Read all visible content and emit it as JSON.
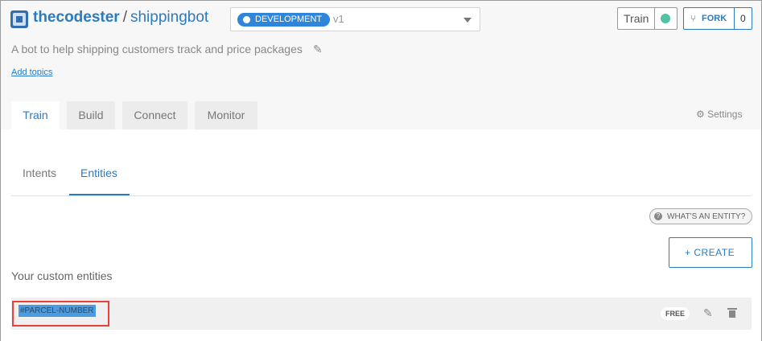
{
  "header": {
    "owner": "thecodester",
    "separator": "/",
    "bot": "shippingbot",
    "version": {
      "environment": "DEVELOPMENT",
      "version": "v1"
    },
    "train_label": "Train",
    "train_status_color": "#50c3a3",
    "fork_label": "FORK",
    "fork_count": "0"
  },
  "description": "A bot to help shipping customers track and price packages",
  "add_topics": "Add topics",
  "tabs": [
    {
      "label": "Train",
      "active": true
    },
    {
      "label": "Build",
      "active": false
    },
    {
      "label": "Connect",
      "active": false
    },
    {
      "label": "Monitor",
      "active": false
    }
  ],
  "settings_label": "Settings",
  "subtabs": [
    {
      "label": "Intents",
      "active": false
    },
    {
      "label": "Entities",
      "active": true
    }
  ],
  "whats_entity": "WHAT'S AN ENTITY?",
  "create_label": "+ CREATE",
  "custom_entities_label": "Your custom entities",
  "entities": [
    {
      "name": "#PARCEL-NUMBER",
      "plan": "FREE"
    }
  ],
  "colors": {
    "accent": "#2b7bbf",
    "environment_pill": "#2f86d8",
    "highlight_border": "#e8403a"
  },
  "icons": [
    "logo-icon",
    "chevron-down-icon",
    "fork-icon",
    "pencil-icon",
    "gear-icon",
    "question-icon",
    "edit-icon",
    "trash-icon"
  ]
}
